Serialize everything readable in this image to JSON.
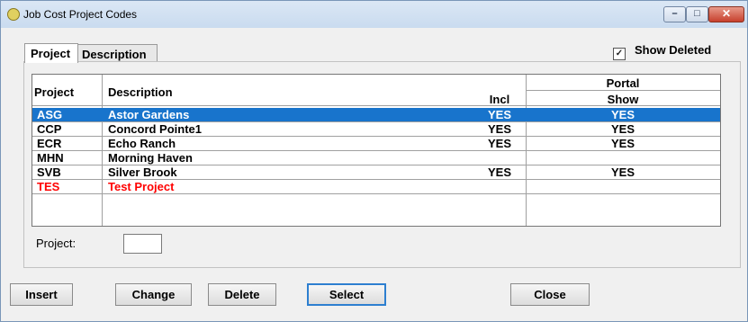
{
  "window": {
    "title": "Job Cost Project Codes",
    "controls": {
      "minimize": "–",
      "maximize": "□",
      "close": "✕"
    }
  },
  "tabs": [
    {
      "label": "Project",
      "active": true
    },
    {
      "label": "Description",
      "active": false
    }
  ],
  "show_deleted": {
    "label": "Show Deleted",
    "checked": true,
    "mark": "✓"
  },
  "table": {
    "headers": {
      "code": "Project",
      "description": "Description",
      "portal": "Portal",
      "incl": "Incl",
      "show": "Show"
    },
    "rows": [
      {
        "code": "ASG",
        "description": "Astor Gardens",
        "incl": "YES",
        "show": "YES",
        "selected": true,
        "deleted": false
      },
      {
        "code": "CCP",
        "description": "Concord Pointe1",
        "incl": "YES",
        "show": "YES",
        "selected": false,
        "deleted": false
      },
      {
        "code": "ECR",
        "description": "Echo Ranch",
        "incl": "YES",
        "show": "YES",
        "selected": false,
        "deleted": false
      },
      {
        "code": "MHN",
        "description": "Morning Haven",
        "incl": "",
        "show": "",
        "selected": false,
        "deleted": false
      },
      {
        "code": "SVB",
        "description": "Silver Brook",
        "incl": "YES",
        "show": "YES",
        "selected": false,
        "deleted": false
      },
      {
        "code": "TES",
        "description": "Test Project",
        "incl": "",
        "show": "",
        "selected": false,
        "deleted": true
      }
    ]
  },
  "project_field": {
    "label": "Project:",
    "value": ""
  },
  "buttons": {
    "insert": "Insert",
    "change": "Change",
    "delete": "Delete",
    "select": "Select",
    "close": "Close"
  },
  "colors": {
    "selection": "#1874cc",
    "deleted_text": "#ff0000",
    "default_button_border": "#2d7fd0"
  }
}
